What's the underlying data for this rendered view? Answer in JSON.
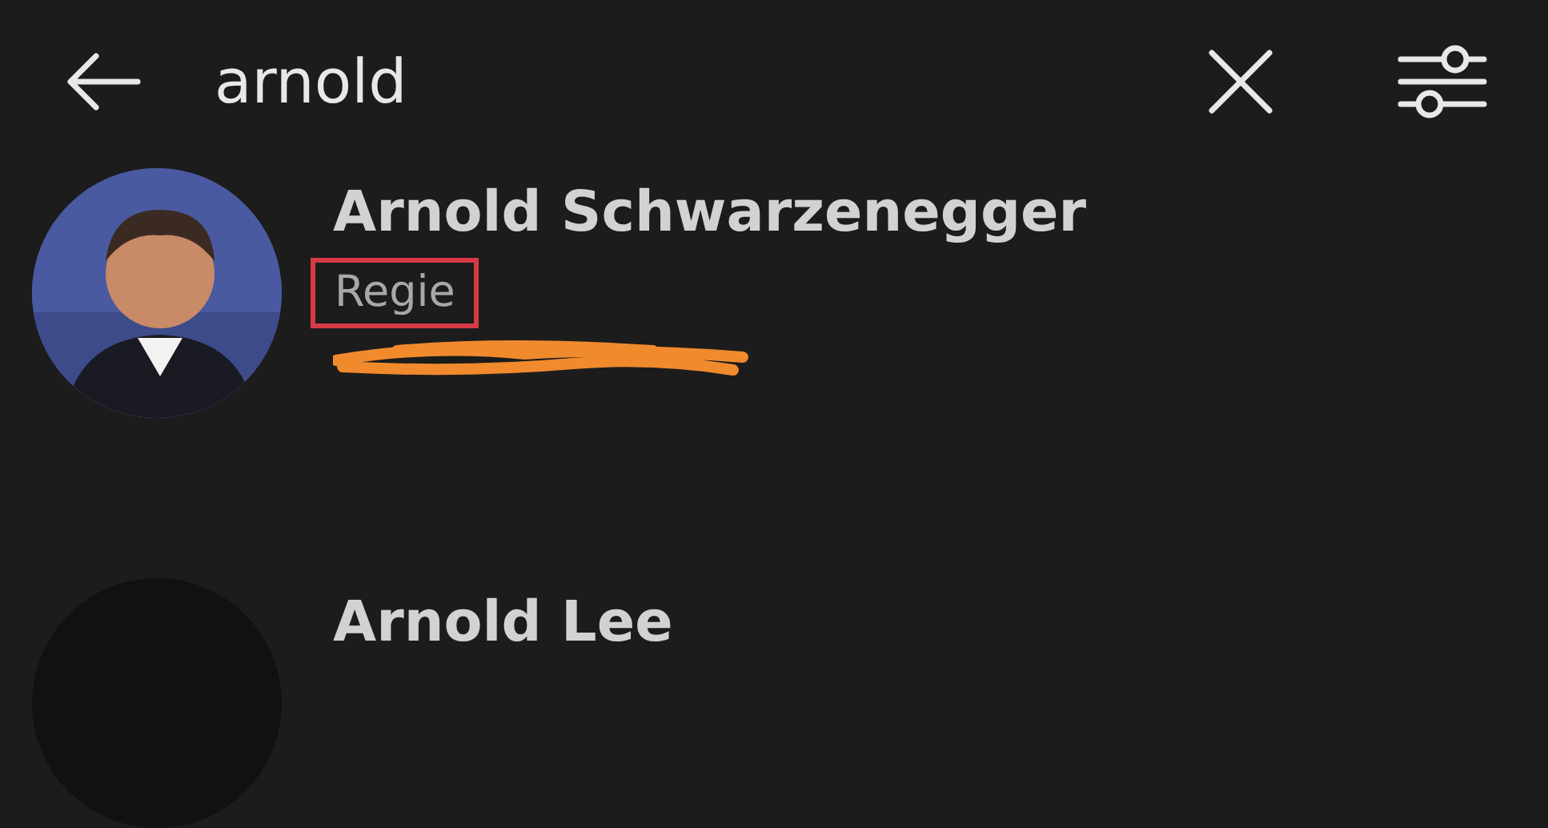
{
  "search": {
    "value": "arnold"
  },
  "results": [
    {
      "name": "Arnold Schwarzenegger",
      "role": "Regie",
      "role_highlighted": true,
      "redacted_line": true,
      "kind": "picture"
    },
    {
      "name": "Arnold Lee",
      "kind": "blank"
    }
  ]
}
